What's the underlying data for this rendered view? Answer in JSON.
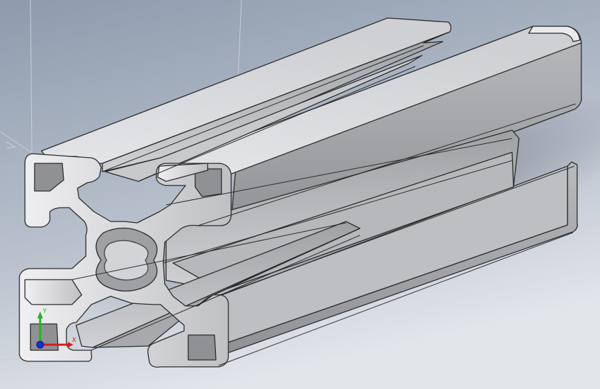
{
  "view": {
    "background_top": "#8e9cae",
    "background_bottom": "#dde1e8",
    "model_name": "aluminum-t-slot-extrusion"
  },
  "triad": {
    "x_label": "X",
    "y_label": "Y",
    "x_color": "#d41c1c",
    "y_color": "#22b322",
    "z_color": "#1a2fd6"
  },
  "colors": {
    "extrusion_light": "#d6d7da",
    "extrusion_mid": "#a9abaf",
    "extrusion_dark": "#6e7074",
    "edge": "#2a2a2a"
  }
}
